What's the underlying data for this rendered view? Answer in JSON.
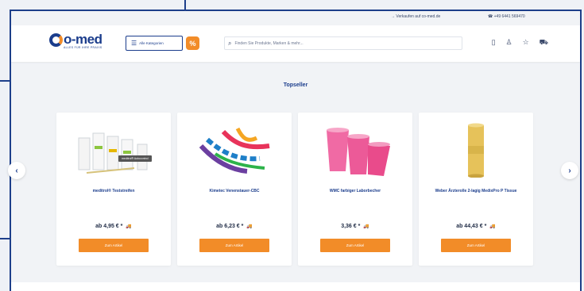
{
  "topbar": {
    "sell_link": "→ Verkaufen auf co-med.de",
    "phone": "☎ +49 6441 569470"
  },
  "header": {
    "logo_text": "o-med",
    "logo_tagline": "ALLES FÜR IHRE PRAXIS",
    "categories_label": "Alle Kategorien",
    "badge": "%",
    "search_placeholder": "Finden Sie Produkte, Marken & mehr..."
  },
  "section": {
    "title": "Topseller"
  },
  "products": [
    {
      "name": "meditrol® Teststreifen",
      "price": "ab 4,95 € *",
      "tooltip": "meditrol® Autocontrol",
      "button": "Zum Artikel"
    },
    {
      "name": "Kimetec Venenstauer-CBC",
      "price": "ab 6,23 € *",
      "button": "Zum Artikel"
    },
    {
      "name": "WMC farbiger Laborbecher",
      "price": "3,36 € *",
      "button": "Zum Artikel"
    },
    {
      "name": "Weber Ärzterolle 2-lagig MedixPro P Tissue",
      "price": "ab 44,43 € *",
      "button": "Zum Artikel"
    }
  ],
  "icons": {
    "prev": "‹",
    "next": "›",
    "ship": "🚚"
  },
  "colors": {
    "brand_blue": "#1b3d8c",
    "accent_orange": "#f28c28",
    "ship_green": "#6bb32e"
  }
}
